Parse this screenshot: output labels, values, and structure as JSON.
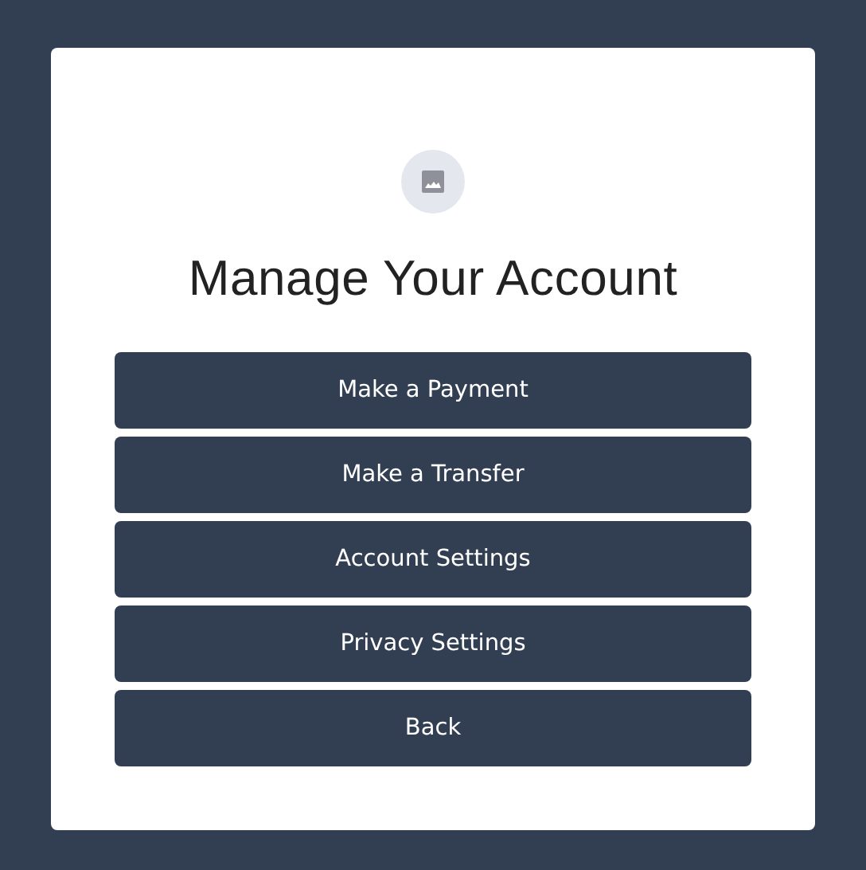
{
  "title": "Manage Your Account",
  "buttons": [
    "Make a Payment",
    "Make a Transfer",
    "Account Settings",
    "Privacy Settings",
    "Back"
  ]
}
